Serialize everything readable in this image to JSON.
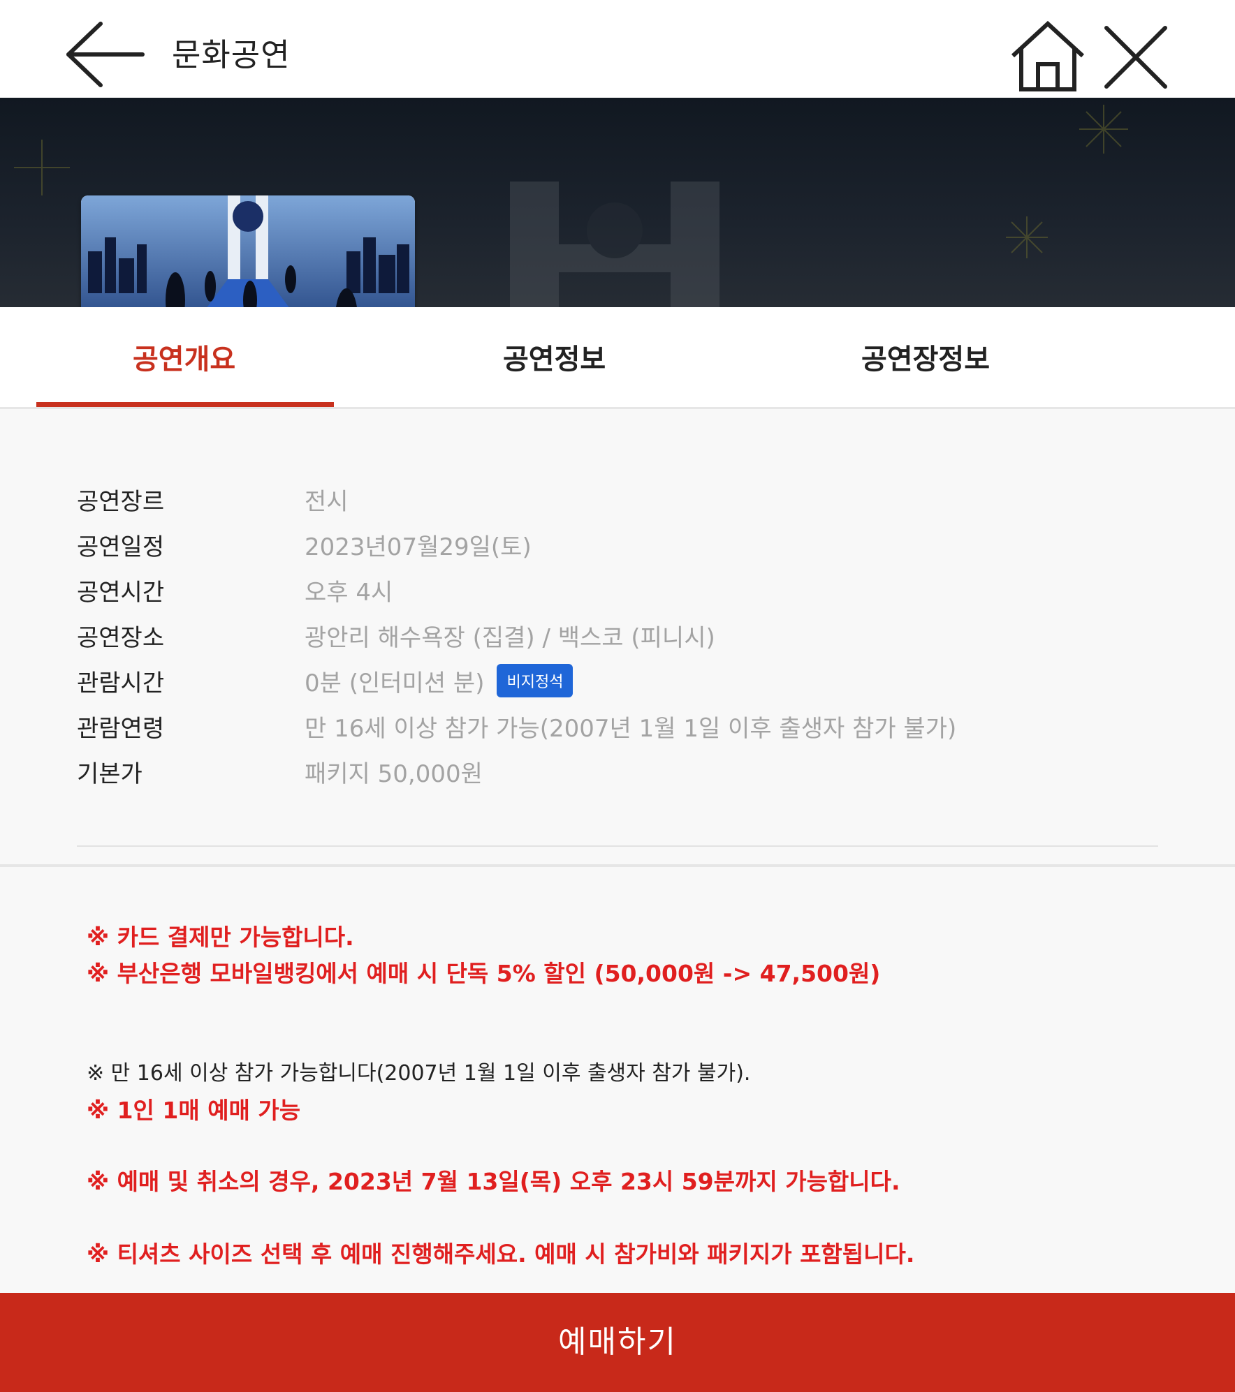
{
  "header": {
    "title": "문화공연",
    "back_icon": "arrow-left-icon",
    "home_icon": "home-icon",
    "close_icon": "close-icon"
  },
  "tabs": [
    {
      "label": "공연개요",
      "active": true
    },
    {
      "label": "공연정보",
      "active": false
    },
    {
      "label": "공연장정보",
      "active": false
    }
  ],
  "info": [
    {
      "label": "공연장르",
      "value": "전시"
    },
    {
      "label": "공연일정",
      "value": "2023년07월29일(토)"
    },
    {
      "label": "공연시간",
      "value": "오후 4시"
    },
    {
      "label": "공연장소",
      "value": "광안리 해수욕장 (집결) / 백스코 (피니시)"
    },
    {
      "label": "관람시간",
      "value": "0분 (인터미션 분)",
      "badge": "비지정석"
    },
    {
      "label": "관람연령",
      "value": "만 16세 이상 참가 가능(2007년 1월 1일 이후 출생자 참가 불가)"
    },
    {
      "label": "기본가",
      "value": "패키지 50,000원"
    }
  ],
  "notices": [
    {
      "text": "※ 카드 결제만 가능합니다.",
      "style": "red"
    },
    {
      "text": "※ 부산은행 모바일뱅킹에서 예매 시 단독 5% 할인 (50,000원 -> 47,500원)",
      "style": "red"
    },
    {
      "text": "※ 만 16세 이상 참가 가능합니다(2007년 1월 1일 이후 출생자 참가 불가).",
      "style": "black"
    },
    {
      "text": "※ 1인 1매 예매 가능",
      "style": "red"
    },
    {
      "text": "※ 예매 및 취소의 경우, 2023년 7월 13일(목) 오후 23시 59분까지 가능합니다.",
      "style": "red"
    },
    {
      "text": "※ 티셔츠 사이즈 선택 후 예매 진행해주세요. 예매 시 참가비와 패키지가 포함됩니다.",
      "style": "red"
    }
  ],
  "cta": {
    "label": "예매하기"
  },
  "colors": {
    "accent": "#c8311e",
    "notice_red": "#e01f1f",
    "badge_blue": "#1f66d8",
    "cta_bg": "#c8291a"
  }
}
